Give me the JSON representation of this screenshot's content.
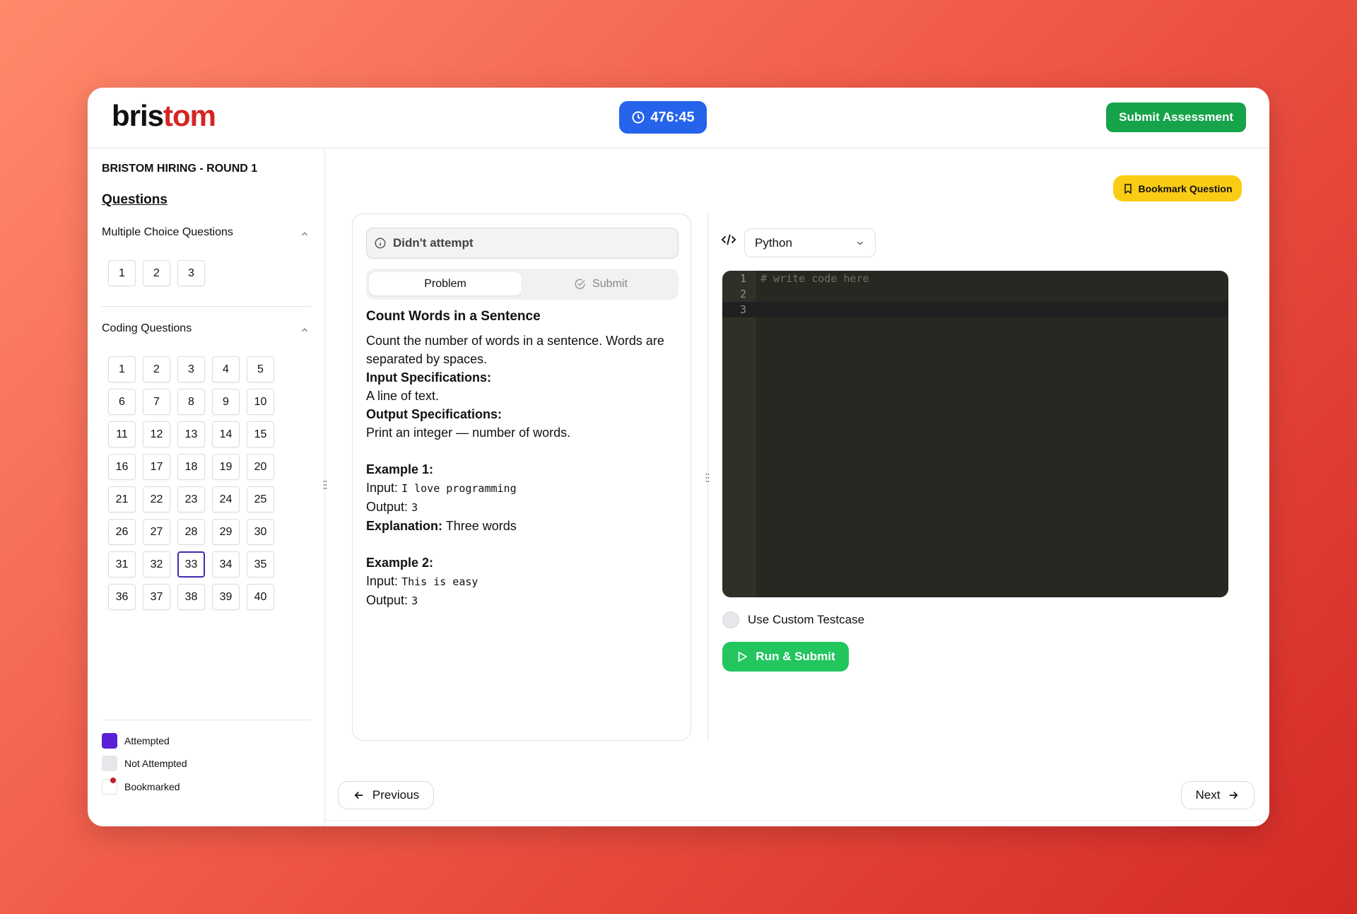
{
  "header": {
    "logo_part1": "bris",
    "logo_part2": "tom",
    "timer": "476:45",
    "submit_assessment": "Submit Assessment"
  },
  "sidebar": {
    "round_title": "BRISTOM HIRING - ROUND 1",
    "questions_heading": "Questions",
    "mcq_heading": "Multiple Choice Questions",
    "mcq_numbers": [
      "1",
      "2",
      "3"
    ],
    "coding_heading": "Coding Questions",
    "coding_numbers": [
      "1",
      "2",
      "3",
      "4",
      "5",
      "6",
      "7",
      "8",
      "9",
      "10",
      "11",
      "12",
      "13",
      "14",
      "15",
      "16",
      "17",
      "18",
      "19",
      "20",
      "21",
      "22",
      "23",
      "24",
      "25",
      "26",
      "27",
      "28",
      "29",
      "30",
      "31",
      "32",
      "33",
      "34",
      "35",
      "36",
      "37",
      "38",
      "39",
      "40"
    ],
    "active_coding_question": "33",
    "legend": {
      "attempted": "Attempted",
      "not_attempted": "Not Attempted",
      "bookmarked": "Bookmarked"
    }
  },
  "main": {
    "bookmark_button": "Bookmark Question",
    "status": "Didn't attempt",
    "tabs": {
      "problem": "Problem",
      "submit": "Submit"
    },
    "problem": {
      "title": "Count Words in a Sentence",
      "description": "Count the number of words in a sentence. Words are separated by spaces.",
      "input_spec_label": "Input Specifications:",
      "input_spec": "A line of text.",
      "output_spec_label": "Output Specifications:",
      "output_spec": "Print an integer — number of words.",
      "example1_label": "Example 1:",
      "input_label": "Input:",
      "output_label": "Output:",
      "explanation_label": "Explanation:",
      "example1_input": "I love programming",
      "example1_output": "3",
      "example1_explanation": "Three words",
      "example2_label": "Example 2:",
      "example2_input": "This is easy",
      "example2_output": "3"
    },
    "editor": {
      "language": "Python",
      "lines": [
        "# write code here",
        "",
        ""
      ],
      "line_numbers": [
        "1",
        "2",
        "3"
      ]
    },
    "custom_testcase_label": "Use Custom Testcase",
    "run_submit": "Run & Submit",
    "previous": "Previous",
    "next": "Next"
  },
  "colors": {
    "timer_bg": "#2563eb",
    "submit_bg": "#16a34a",
    "bookmark_bg": "#facc15",
    "attempted": "#5b21d6",
    "run_bg": "#22c55e",
    "brand_red": "#d62424"
  }
}
